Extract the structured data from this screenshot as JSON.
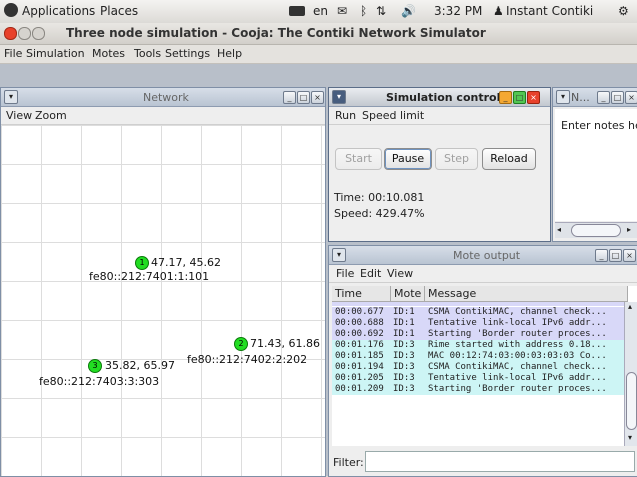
{
  "system_bar": {
    "applications": "Applications",
    "places": "Places",
    "lang": "en",
    "time": "3:32 PM",
    "user": "Instant Contiki"
  },
  "window": {
    "title": "Three node simulation - Cooja: The Contiki Network Simulator"
  },
  "menubar": [
    "File",
    "Simulation",
    "Motes",
    "Tools",
    "Settings",
    "Help"
  ],
  "network": {
    "title": "Network",
    "menu": [
      "View",
      "Zoom"
    ],
    "motes": [
      {
        "id": "1",
        "coords": "47.17, 45.62",
        "addr": "fe80::212:7401:1:101"
      },
      {
        "id": "2",
        "coords": "71.43, 61.86",
        "addr": "fe80::212:7402:2:202"
      },
      {
        "id": "3",
        "coords": "35.82, 65.97",
        "addr": "fe80::212:7403:3:303"
      }
    ]
  },
  "sim_control": {
    "title": "Simulation control",
    "menu": [
      "Run",
      "Speed limit"
    ],
    "buttons": {
      "start": "Start",
      "pause": "Pause",
      "step": "Step",
      "reload": "Reload"
    },
    "time": "Time: 00:10.081",
    "speed": "Speed: 429.47%"
  },
  "notes": {
    "title": "N...",
    "text": "Enter notes her"
  },
  "mote_output": {
    "title": "Mote output",
    "menu": [
      "File",
      "Edit",
      "View"
    ],
    "columns": [
      "Time",
      "Mote",
      "Message"
    ],
    "rows": [
      {
        "time": "00:00.677",
        "mote": "ID:1",
        "msg": "CSMA ContikiMAC, channel check...",
        "color": "#d8d8f8"
      },
      {
        "time": "00:00.688",
        "mote": "ID:1",
        "msg": "Tentative link-local IPv6 addr...",
        "color": "#d8d8f8"
      },
      {
        "time": "00:00.692",
        "mote": "ID:1",
        "msg": "Starting 'Border router proces...",
        "color": "#d8d8f8"
      },
      {
        "time": "00:01.176",
        "mote": "ID:3",
        "msg": "Rime started with address 0.18...",
        "color": "#cdf5f5"
      },
      {
        "time": "00:01.185",
        "mote": "ID:3",
        "msg": "MAC 00:12:74:03:00:03:03:03 Co...",
        "color": "#cdf5f5"
      },
      {
        "time": "00:01.194",
        "mote": "ID:3",
        "msg": "CSMA ContikiMAC, channel check...",
        "color": "#cdf5f5"
      },
      {
        "time": "00:01.205",
        "mote": "ID:3",
        "msg": "Tentative link-local IPv6 addr...",
        "color": "#cdf5f5"
      },
      {
        "time": "00:01.209",
        "mote": "ID:3",
        "msg": "Starting 'Border router proces...",
        "color": "#cdf5f5"
      }
    ],
    "filter_label": "Filter:"
  },
  "colors": {
    "mote_green": "#22dd22",
    "title_blue": "#b9c4d2",
    "close_red": "#e8412b"
  }
}
